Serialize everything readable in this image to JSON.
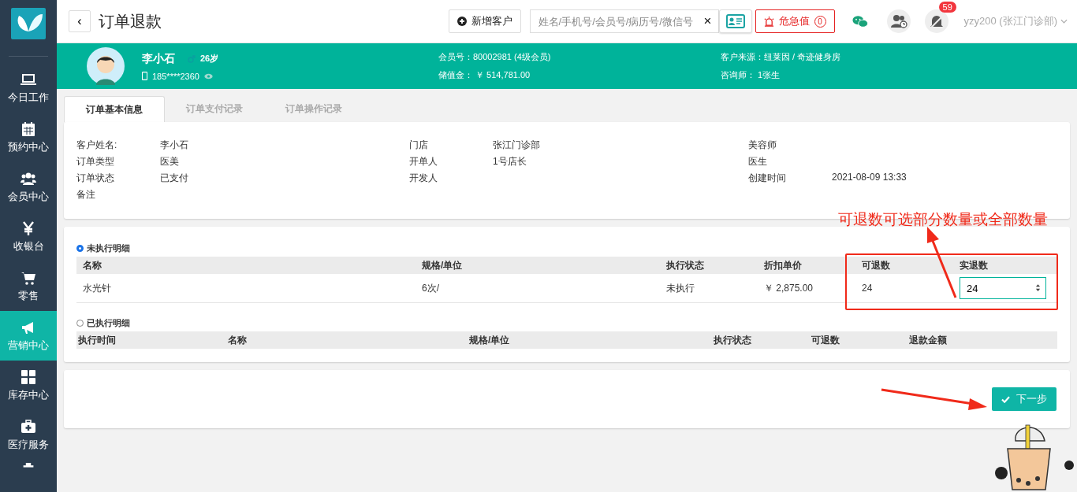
{
  "header": {
    "back": "‹",
    "title": "订单退款",
    "add_customer": "新增客户",
    "search": {
      "placeholder": "姓名/手机号/会员号/病历号/微信号"
    },
    "clear": "×",
    "alert": {
      "label": "危急值",
      "count": "0"
    },
    "notification_count": "59",
    "user": "yzy200 (张江门诊部)"
  },
  "sidebar": {
    "items": [
      {
        "label": "今日工作",
        "selected": false
      },
      {
        "label": "预约中心",
        "selected": false
      },
      {
        "label": "会员中心",
        "selected": false
      },
      {
        "label": "收银台",
        "selected": false
      },
      {
        "label": "零售",
        "selected": false
      },
      {
        "label": "营销中心",
        "selected": true
      },
      {
        "label": "库存中心",
        "selected": false
      },
      {
        "label": "医疗服务",
        "selected": false
      }
    ]
  },
  "customer": {
    "name": "李小石",
    "age": "26岁",
    "phone": "185****2360",
    "fields": [
      "会员号：80002981 (4级会员)",
      "储值金： ￥ 514,781.00",
      "客户来源：纽莱因 / 奇迹健身房",
      "咨询师： 1张生"
    ]
  },
  "tabs": [
    {
      "label": "订单基本信息",
      "selected": true
    },
    {
      "label": "订单支付记录",
      "selected": false
    },
    {
      "label": "订单操作记录",
      "selected": false
    }
  ],
  "info": [
    [
      {
        "label": "客户姓名:",
        "value": "李小石"
      },
      {
        "label": "订单类型",
        "value": "医美"
      },
      {
        "label": "订单状态",
        "value": "已支付"
      },
      {
        "label": "备注"
      }
    ],
    [
      {
        "label": "门店",
        "value": "张江门诊部"
      },
      {
        "label": "开单人",
        "value": "1号店长"
      },
      {
        "label": "开发人"
      }
    ],
    [
      {
        "label": "美容师"
      },
      {
        "label": "医生"
      },
      {
        "label": "创建时间",
        "value": "2021-08-09 13:33"
      }
    ]
  ],
  "unexecuted": {
    "label": "未执行明细",
    "selected": true,
    "columns": [
      "名称",
      "规格/单位",
      "执行状态",
      "折扣单价",
      "可退数",
      "实退数"
    ],
    "rows": [
      {
        "cells": [
          "水光针",
          "6次/",
          "未执行",
          "￥ 2,875.00",
          "24"
        ],
        "refund": "24"
      }
    ]
  },
  "executed": {
    "label": "已执行明细",
    "selected": false,
    "columns": [
      "执行时间",
      "名称",
      "规格/单位",
      "执行状态",
      "可退数",
      "退款金额"
    ]
  },
  "next_button": "下一步",
  "annotation": "可退数可选部分数量或全部数量"
}
